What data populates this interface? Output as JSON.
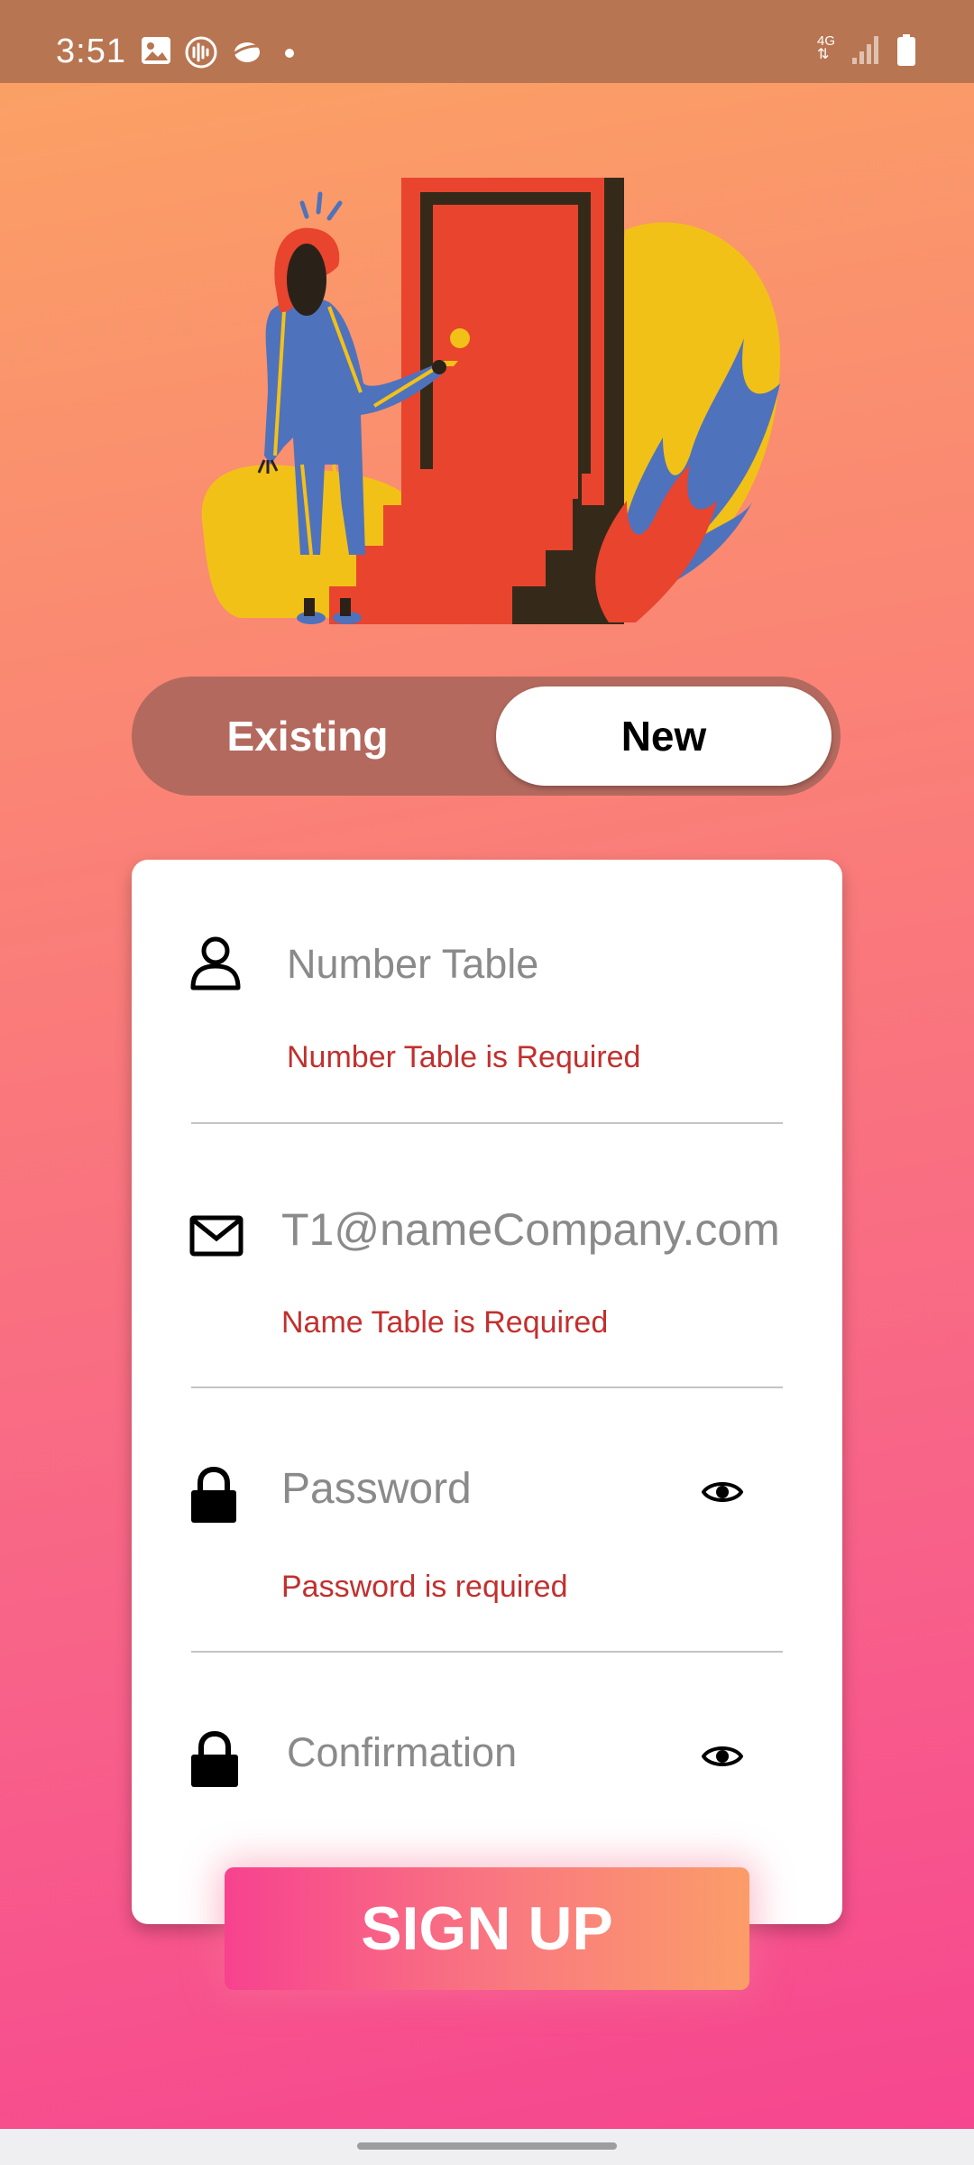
{
  "status_bar": {
    "time": "3:51",
    "left_icons": [
      "image-icon",
      "audio-icon",
      "planet-icon",
      "dot-icon"
    ],
    "network": "4G",
    "right_icons": [
      "network-4g-icon",
      "signal-icon",
      "battery-icon"
    ]
  },
  "auth_toggle": {
    "existing_label": "Existing",
    "new_label": "New",
    "selected": "New"
  },
  "form": {
    "number_table": {
      "icon": "person-icon",
      "placeholder": "Number Table",
      "error": "Number Table is Required"
    },
    "email": {
      "icon": "mail-icon",
      "placeholder": "T1@nameCompany.com",
      "error": "Name Table  is Required"
    },
    "password": {
      "icon": "lock-icon",
      "placeholder": "Password",
      "error": "Password is required",
      "toggle_icon": "eye-icon"
    },
    "confirmation": {
      "icon": "lock-icon",
      "placeholder": "Confirmation",
      "toggle_icon": "eye-icon"
    }
  },
  "signup_label": "SIGN UP",
  "colors": {
    "error": "#c2302e",
    "toggle_track": "#b4695e",
    "gradient_top": "#fba463",
    "gradient_bottom": "#f6468f",
    "illustration_red": "#e8442e",
    "illustration_yellow": "#f2c118",
    "illustration_blue": "#4f72bc"
  }
}
